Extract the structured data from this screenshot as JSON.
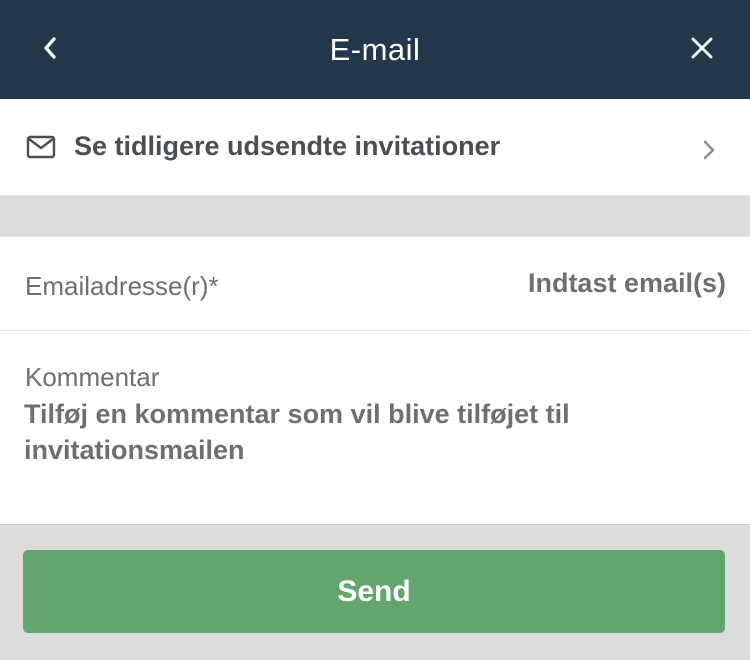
{
  "header": {
    "title": "E-mail",
    "back_icon": "chevron-left-icon",
    "close_icon": "close-icon",
    "background_color": "#23374a"
  },
  "invites": {
    "label": "Se tidligere udsendte invitationer",
    "icon": "mail-icon",
    "chevron_icon": "chevron-right-icon"
  },
  "form": {
    "email_label": "Emailadresse(r)*",
    "email_placeholder": "Indtast email(s)",
    "email_value": "",
    "comment_label": "Kommentar",
    "comment_placeholder": "Tilføj en kommentar som vil blive tilføjet til invitationsmailen",
    "comment_value": ""
  },
  "footer": {
    "send_label": "Send",
    "send_color": "#63a56e"
  }
}
